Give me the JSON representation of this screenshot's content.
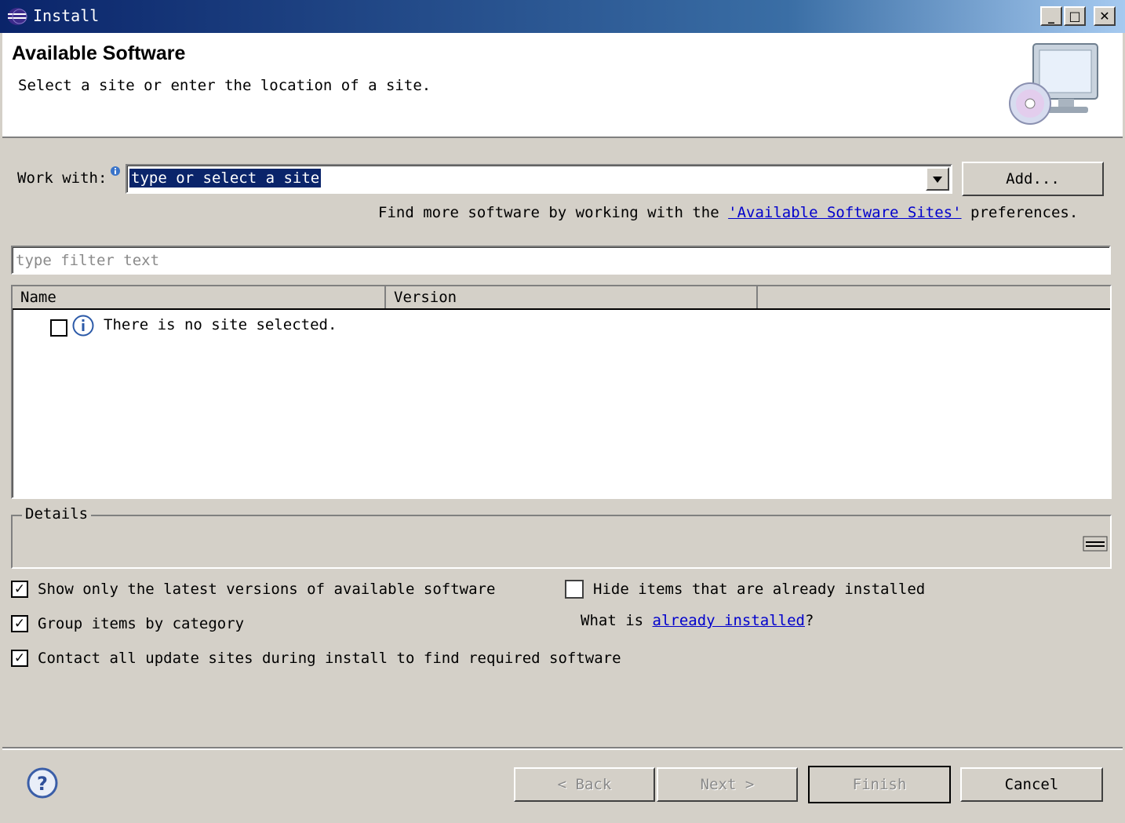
{
  "window": {
    "title": "Install",
    "minimize_label": "_",
    "maximize_label": "□",
    "close_label": "✕"
  },
  "header": {
    "title": "Available Software",
    "description": "Select a site or enter the location of a site."
  },
  "work_with": {
    "label": "Work with:",
    "value": "type or select a site",
    "add_button": "Add...",
    "more_prefix": "Find more software by working with the",
    "more_link": "'Available Software Sites'",
    "more_suffix": "preferences."
  },
  "filter": {
    "placeholder": "type filter text"
  },
  "table": {
    "columns": [
      "Name",
      "Version",
      ""
    ],
    "rows": [
      {
        "checked": false,
        "icon": "info-icon",
        "name": "There is no site selected."
      }
    ]
  },
  "details": {
    "label": "Details"
  },
  "options": {
    "show_latest": {
      "label": "Show only the latest versions of available software",
      "checked": true
    },
    "group_by_category": {
      "label": "Group items by category",
      "checked": true
    },
    "contact_all": {
      "label": "Contact all update sites during install to find required software",
      "checked": true
    },
    "hide_installed": {
      "label": "Hide items that are already installed",
      "checked": false
    },
    "what_is_prefix": "What is",
    "what_is_link": "already installed",
    "what_is_suffix": "?"
  },
  "footer": {
    "help_icon": "help-icon",
    "back": "< Back",
    "next": "Next >",
    "finish": "Finish",
    "cancel": "Cancel"
  },
  "icons": {
    "app": "eclipse-icon",
    "banner": "computer-cd-icon",
    "info": "info-icon",
    "collapse": "details-toggle-icon"
  }
}
